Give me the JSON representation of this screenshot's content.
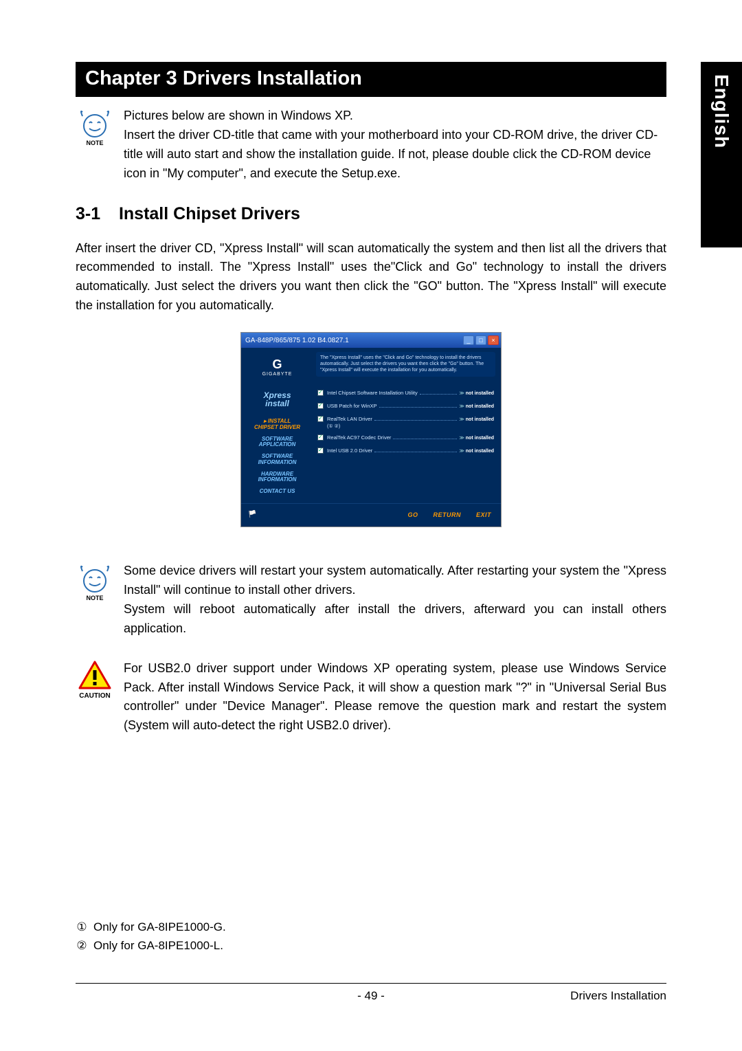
{
  "language_tab": "English",
  "chapter_title": "Chapter 3 Drivers Installation",
  "note1": {
    "label": "NOTE",
    "text": "Pictures below are shown in Windows XP.\nInsert the driver CD-title that came with your motherboard into your CD-ROM drive, the driver CD-title will auto start and show the installation guide. If not, please double click the CD-ROM device icon in \"My computer\", and execute the Setup.exe."
  },
  "section": {
    "number": "3-1",
    "title": "Install Chipset Drivers"
  },
  "section_body": "After insert the driver CD, \"Xpress Install\" will scan automatically the system and then list all the drivers that recommended to install. The \"Xpress Install\" uses the\"Click and Go\" technology to install the drivers automatically. Just select the drivers you want then click the \"GO\" button. The \"Xpress Install\" will execute the installation for you automatically.",
  "screenshot": {
    "window_title": "GA-848P/865/875 1.02 B4.0827.1",
    "window_controls": {
      "min": "_",
      "max": "□",
      "close": "×"
    },
    "logo_brand": "GIGABYTE",
    "xpress_line1": "Xpress",
    "xpress_line2": "install",
    "nav": [
      {
        "label": "INSTALL\nCHIPSET DRIVER",
        "selected": true
      },
      {
        "label": "SOFTWARE\nAPPLICATION",
        "selected": false
      },
      {
        "label": "SOFTWARE\nINFORMATION",
        "selected": false
      },
      {
        "label": "HARDWARE\nINFORMATION",
        "selected": false
      },
      {
        "label": "CONTACT US",
        "selected": false
      }
    ],
    "description": "The \"Xpress Install\" uses the \"Click and Go\" technology to install the drivers automatically. Just select the drivers you want then click the \"Go\" button. The \"Xpress Install\" will execute the installation for you automatically.",
    "drivers": [
      {
        "name": "Intel Chipset Software Installation Utility",
        "status": "not installed",
        "sub": ""
      },
      {
        "name": "USB Patch for WinXP",
        "status": "not installed",
        "sub": ""
      },
      {
        "name": "RealTek LAN Driver",
        "status": "not installed",
        "sub": "(① ②)"
      },
      {
        "name": "RealTek AC97 Codec Driver",
        "status": "not installed",
        "sub": ""
      },
      {
        "name": "Intel USB 2.0 Driver",
        "status": "not installed",
        "sub": ""
      }
    ],
    "buttons": {
      "go": "GO",
      "return": "RETURN",
      "exit": "EXIT"
    }
  },
  "note2": {
    "label": "NOTE",
    "text": "Some device drivers will restart your system automatically. After restarting your system the \"Xpress Install\" will continue to install other drivers.\nSystem will reboot automatically after install the drivers, afterward you can install others application."
  },
  "caution": {
    "label": "CAUTION",
    "text": "For USB2.0 driver support under Windows XP operating system, please use Windows Service Pack. After install Windows Service Pack, it will show a question mark \"?\" in \"Universal Serial Bus controller\" under \"Device Manager\". Please remove the question mark and restart the system (System will auto-detect the right USB2.0 driver)."
  },
  "footnotes": {
    "fn1_marker": "①",
    "fn1_text": "Only for GA-8IPE1000-G.",
    "fn2_marker": "②",
    "fn2_text": "Only for GA-8IPE1000-L."
  },
  "footer": {
    "page": "- 49 -",
    "section": "Drivers Installation"
  }
}
